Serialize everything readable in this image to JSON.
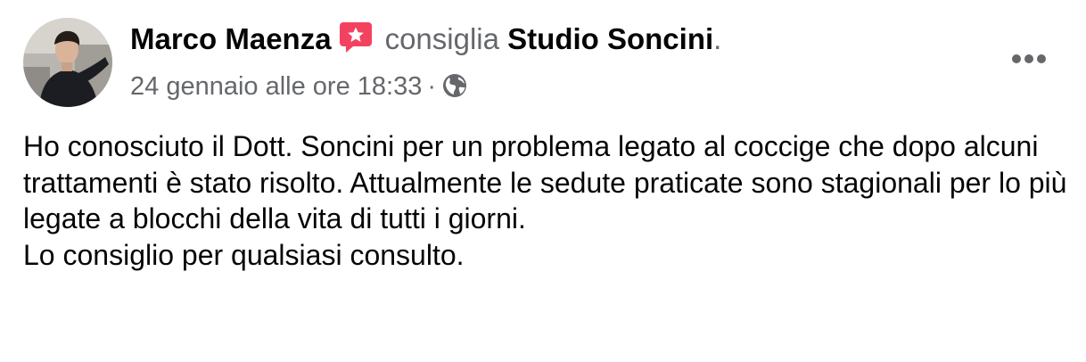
{
  "post": {
    "author": "Marco Maenza",
    "action": "consiglia",
    "page_name": "Studio Soncini",
    "period": ".",
    "timestamp": "24 gennaio alle ore 18:33",
    "separator": "·",
    "privacy_icon": "globe-icon",
    "recommend_icon": "recommend-star-icon",
    "more_icon": "more-options-icon",
    "paragraphs": [
      "Ho conosciuto il Dott. Soncini per un problema legato al coccige che dopo alcuni trattamenti è stato risolto. Attualmente le sedute praticate sono stagionali per lo più legate a blocchi della vita di tutti i giorni.",
      "Lo consiglio per qualsiasi consulto."
    ]
  },
  "colors": {
    "text_primary": "#050505",
    "text_secondary": "#65676b",
    "recommend_red": "#f3425f"
  }
}
